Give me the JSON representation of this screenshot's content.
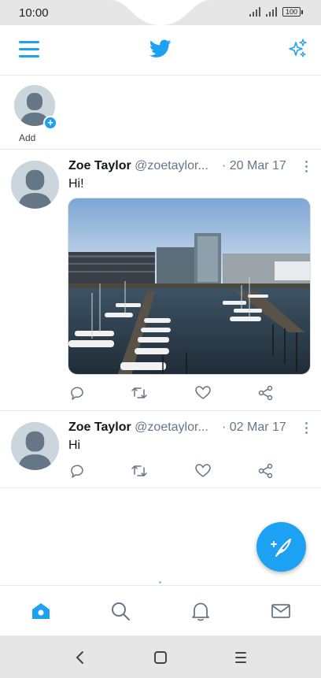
{
  "status_bar": {
    "time": "10:00",
    "battery": "100"
  },
  "app": {
    "title_icon": "twitter-bird-icon",
    "accent": "#1da1f2"
  },
  "fleets": {
    "add_label": "Add"
  },
  "tweets": [
    {
      "name": "Zoe Taylor",
      "handle": "@zoetaylor...",
      "date": "· 20 Mar 17",
      "text": "Hi!",
      "has_image": true
    },
    {
      "name": "Zoe Taylor",
      "handle": "@zoetaylor...",
      "date": "· 02 Mar 17",
      "text": "Hi",
      "has_image": false
    }
  ],
  "tweet_actions": [
    "reply-icon",
    "retweet-icon",
    "like-icon",
    "share-icon"
  ],
  "bottom_nav": [
    "home-icon",
    "search-icon",
    "notifications-icon",
    "messages-icon"
  ],
  "system_nav": [
    "back-icon",
    "home-circle-icon",
    "menu-icon"
  ]
}
